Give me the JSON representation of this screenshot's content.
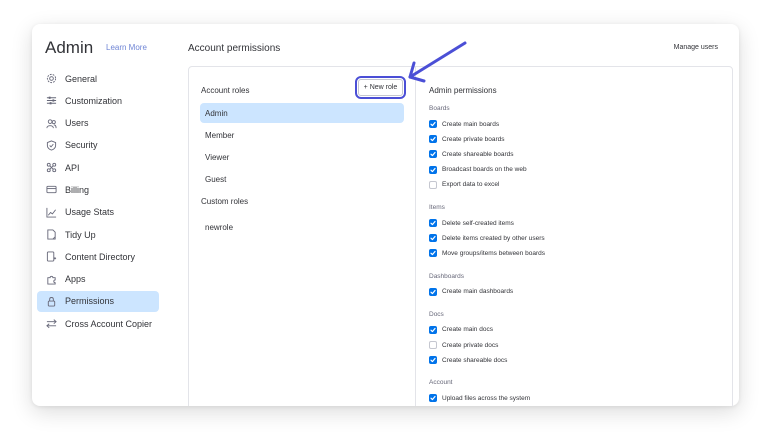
{
  "admin": {
    "title": "Admin",
    "learn_more": "Learn More"
  },
  "nav": [
    {
      "label": "General",
      "icon": "gear-icon"
    },
    {
      "label": "Customization",
      "icon": "sliders-icon"
    },
    {
      "label": "Users",
      "icon": "users-icon"
    },
    {
      "label": "Security",
      "icon": "shield-icon"
    },
    {
      "label": "API",
      "icon": "api-icon"
    },
    {
      "label": "Billing",
      "icon": "billing-card-icon"
    },
    {
      "label": "Usage Stats",
      "icon": "chart-line-icon"
    },
    {
      "label": "Tidy Up",
      "icon": "tidy-up-icon"
    },
    {
      "label": "Content Directory",
      "icon": "content-directory-icon"
    },
    {
      "label": "Apps",
      "icon": "apps-puzzle-icon"
    },
    {
      "label": "Permissions",
      "icon": "lock-icon"
    },
    {
      "label": "Cross Account Copier",
      "icon": "transfer-arrows-icon"
    }
  ],
  "active_nav": "Permissions",
  "header": {
    "title": "Account permissions",
    "manage_users": "Manage users"
  },
  "roles": {
    "title": "Account roles",
    "new_role": "+ New role",
    "items": [
      "Admin",
      "Member",
      "Viewer",
      "Guest"
    ],
    "selected": "Admin",
    "custom_title": "Custom roles",
    "custom_items": [
      "newrole"
    ]
  },
  "permissions": {
    "title": "Admin permissions",
    "groups": [
      {
        "label": "Boards",
        "items": [
          {
            "label": "Create main boards",
            "checked": true
          },
          {
            "label": "Create private boards",
            "checked": true
          },
          {
            "label": "Create shareable boards",
            "checked": true
          },
          {
            "label": "Broadcast boards on the web",
            "checked": true
          },
          {
            "label": "Export data to excel",
            "checked": false
          }
        ]
      },
      {
        "label": "Items",
        "items": [
          {
            "label": "Delete self-created items",
            "checked": true
          },
          {
            "label": "Delete items created by other users",
            "checked": true
          },
          {
            "label": "Move groups/items between boards",
            "checked": true
          }
        ]
      },
      {
        "label": "Dashboards",
        "items": [
          {
            "label": "Create main dashboards",
            "checked": true
          }
        ]
      },
      {
        "label": "Docs",
        "items": [
          {
            "label": "Create main docs",
            "checked": true
          },
          {
            "label": "Create private docs",
            "checked": false
          },
          {
            "label": "Create shareable docs",
            "checked": true
          }
        ]
      },
      {
        "label": "Account",
        "items": [
          {
            "label": "Upload files across the system",
            "checked": true
          }
        ]
      }
    ]
  },
  "colors": {
    "accent": "#0073ea",
    "selected_bg": "#cce5ff",
    "highlight": "#4b4fd6",
    "link": "#6f85d5"
  }
}
